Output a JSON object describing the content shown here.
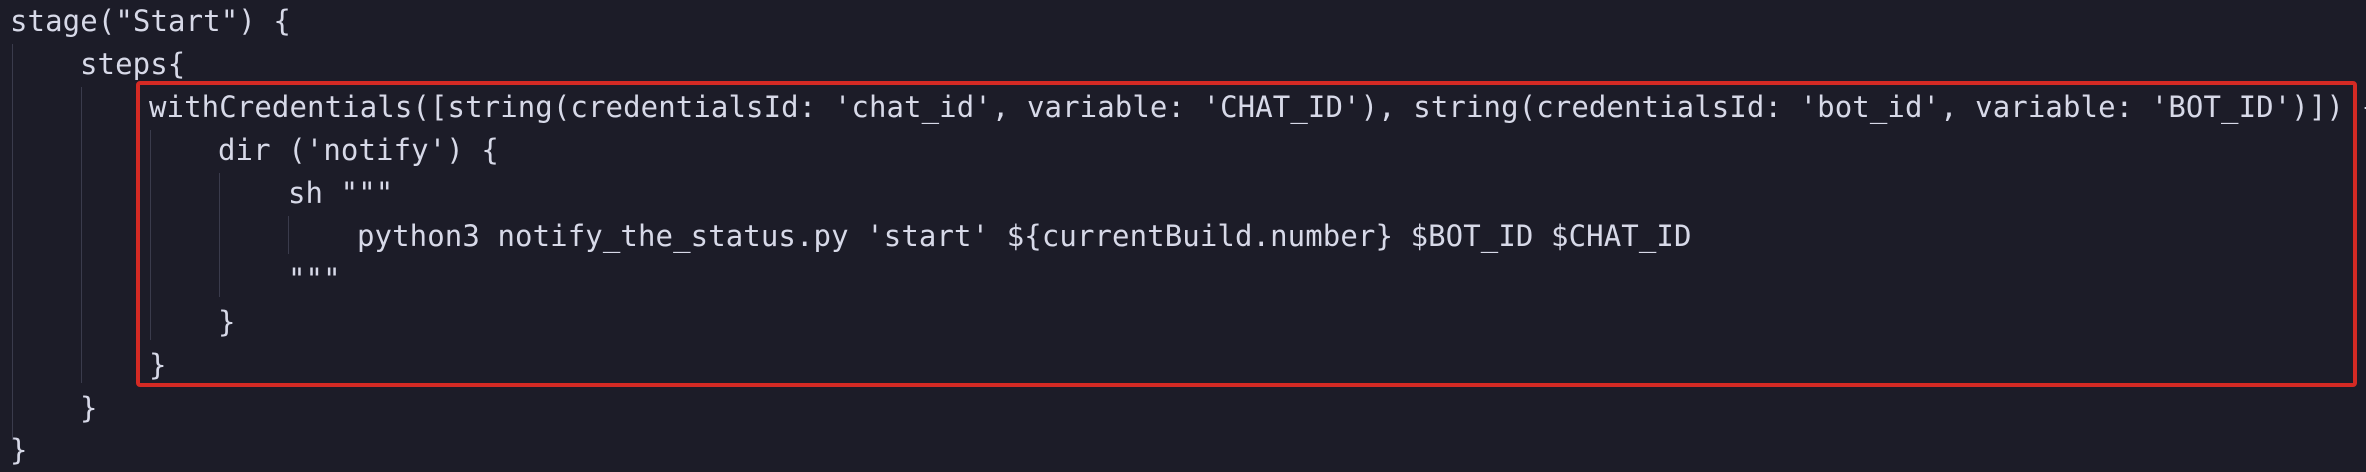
{
  "editor": {
    "background": "#1c1c28",
    "text_color": "#d7d9e8",
    "highlight_color": "#d42a24",
    "lines": [
      "stage(\"Start\") {",
      "steps{",
      "withCredentials([string(credentialsId: 'chat_id', variable: 'CHAT_ID'), string(credentialsId: 'bot_id', variable: 'BOT_ID')]) {",
      "dir ('notify') {",
      "sh \"\"\"",
      "python3 notify_the_status.py 'start' ${currentBuild.number} $BOT_ID $CHAT_ID",
      "\"\"\"",
      "}",
      "}",
      "}",
      "}"
    ]
  }
}
